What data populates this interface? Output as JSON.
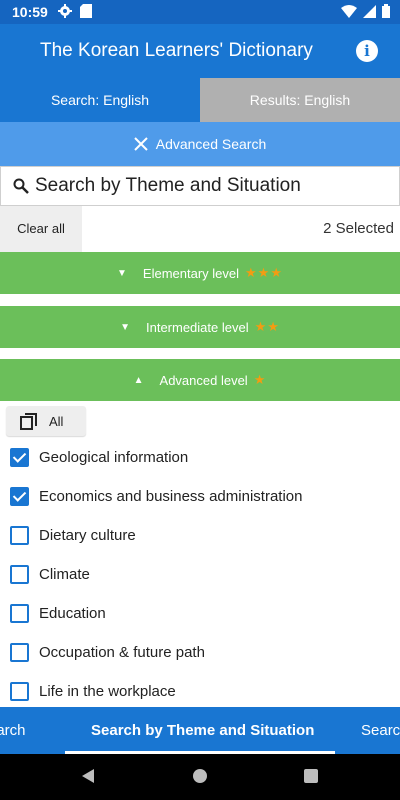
{
  "status_bar": {
    "time": "10:59"
  },
  "app_bar": {
    "title": "The Korean Learners' Dictionary"
  },
  "tabs": [
    {
      "label": "Search: English",
      "active": true
    },
    {
      "label": "Results: English",
      "active": false
    }
  ],
  "advanced_search": {
    "label": "Advanced Search"
  },
  "theme_search": {
    "label": "Search by Theme and Situation"
  },
  "selection": {
    "clear_label": "Clear all",
    "count_text": "2 Selected"
  },
  "levels": [
    {
      "label": "Elementary level",
      "stars": "★★★",
      "expanded": false
    },
    {
      "label": "Intermediate level",
      "stars": "★★",
      "expanded": false
    },
    {
      "label": "Advanced level",
      "stars": "★",
      "expanded": true
    }
  ],
  "all_button": {
    "label": "All"
  },
  "themes": [
    {
      "label": "Geological information",
      "checked": true
    },
    {
      "label": "Economics and business administration",
      "checked": true
    },
    {
      "label": "Dietary culture",
      "checked": false
    },
    {
      "label": "Climate",
      "checked": false
    },
    {
      "label": "Education",
      "checked": false
    },
    {
      "label": "Occupation & future path",
      "checked": false
    },
    {
      "label": "Life in the workplace",
      "checked": false
    }
  ],
  "bottom_tabs": {
    "left": "earch",
    "center": "Search by Theme and Situation",
    "right": "Searc"
  },
  "colors": {
    "primary": "#1976d2",
    "status": "#1565c0",
    "advanced_bar": "#4f9bea",
    "level_bar": "#6bbf5a",
    "star": "#f39c12"
  }
}
